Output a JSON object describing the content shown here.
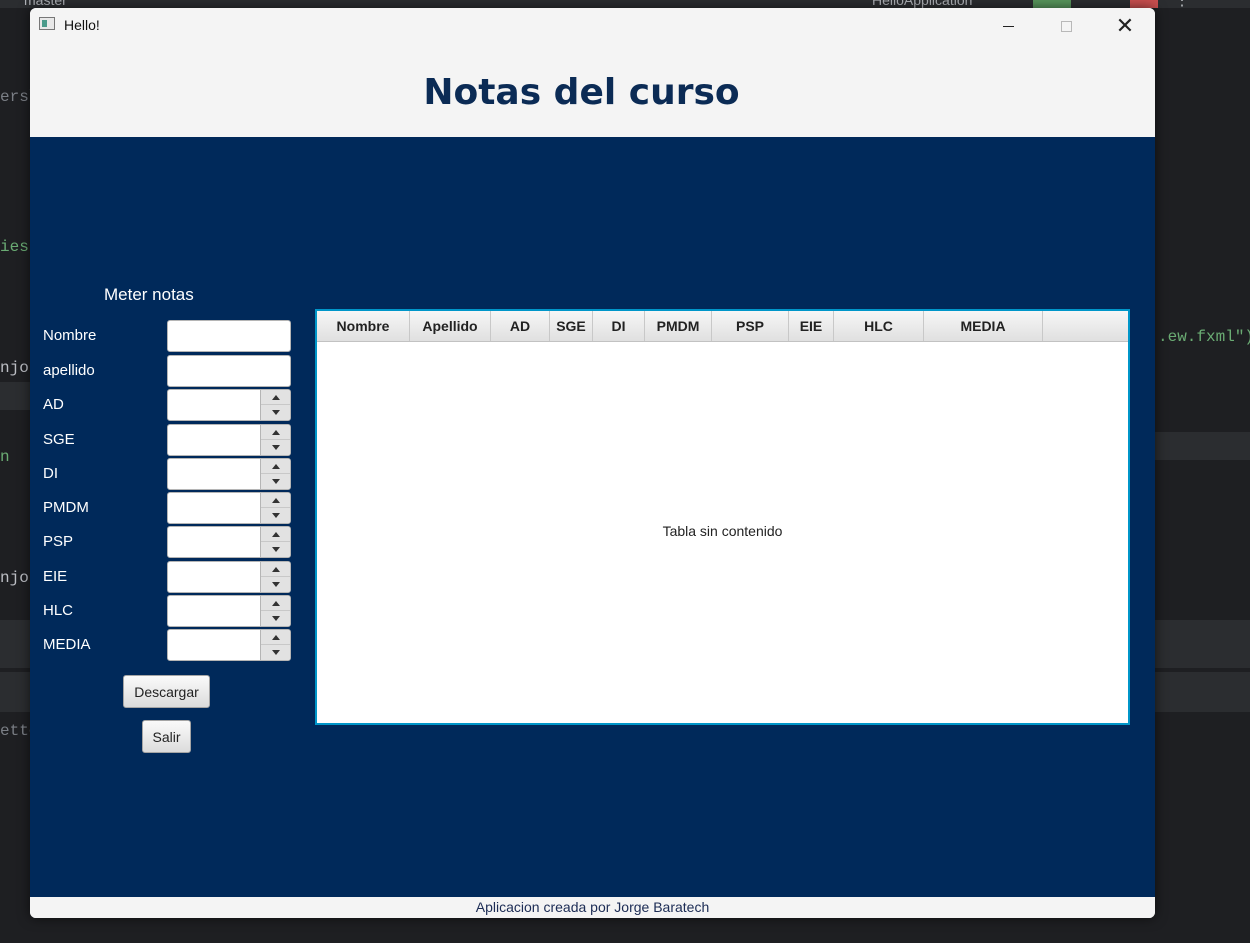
{
  "ide": {
    "branch": "master",
    "run_config": "HelloApplication",
    "left_fragments": [
      "ers\\",
      "ies",
      "njorg",
      "n",
      "njorg",
      "etto"
    ],
    "right_fragment": ".ew.fxml\")"
  },
  "window": {
    "title": "Hello!"
  },
  "header": {
    "title": "Notas del curso"
  },
  "form": {
    "title": "Meter notas",
    "fields": [
      {
        "label": "Nombre",
        "type": "text"
      },
      {
        "label": "apellido",
        "type": "text"
      },
      {
        "label": "AD",
        "type": "spinner"
      },
      {
        "label": "SGE",
        "type": "spinner"
      },
      {
        "label": "DI",
        "type": "spinner"
      },
      {
        "label": "PMDM",
        "type": "spinner"
      },
      {
        "label": "PSP",
        "type": "spinner"
      },
      {
        "label": "EIE",
        "type": "spinner"
      },
      {
        "label": "HLC",
        "type": "spinner"
      },
      {
        "label": "MEDIA",
        "type": "spinner"
      }
    ],
    "download_button": "Descargar",
    "exit_button": "Salir"
  },
  "table": {
    "columns": [
      "Nombre",
      "Apellido",
      "AD",
      "SGE",
      "DI",
      "PMDM",
      "PSP",
      "EIE",
      "HLC",
      "MEDIA"
    ],
    "empty_text": "Tabla sin contenido"
  },
  "footer": {
    "text": "Aplicacion creada por Jorge Baratech"
  },
  "colors": {
    "content_bg": "#00295a",
    "title_color": "#0b2b55",
    "table_focus_border": "#0096c9"
  }
}
